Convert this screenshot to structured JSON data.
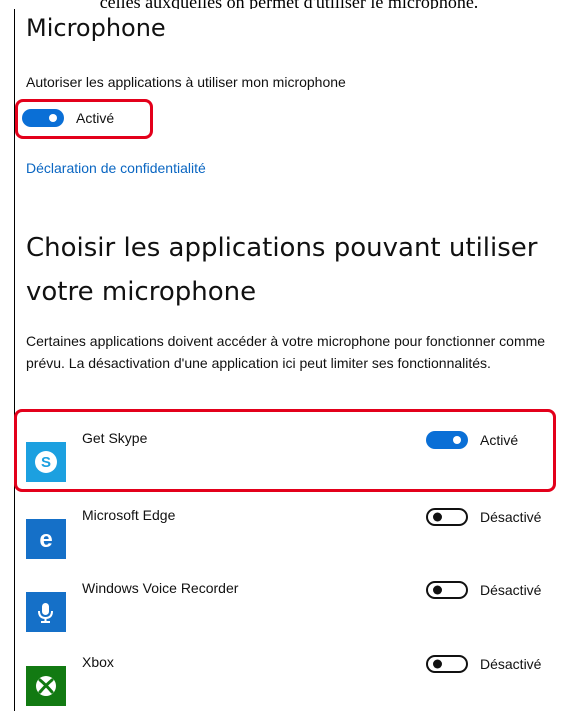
{
  "caption": "celles auxquelles on permet d'utiliser le microphone.",
  "microphone": {
    "title": "Microphone",
    "allow_label": "Autoriser les applications à utiliser mon microphone",
    "toggle_state": "Activé",
    "toggle_on": true,
    "privacy_link": "Déclaration de confidentialité"
  },
  "choose_apps": {
    "title": "Choisir les applications pouvant utiliser votre microphone",
    "description": "Certaines applications doivent accéder à votre microphone pour fonctionner comme prévu. La désactivation d'une application ici peut limiter ses fonctionnalités."
  },
  "apps": [
    {
      "name": "Get Skype",
      "icon": "skype-icon",
      "icon_color": "#1ca0e0",
      "state": "Activé",
      "on": true
    },
    {
      "name": "Microsoft Edge",
      "icon": "edge-icon",
      "icon_color": "#1570c8",
      "state": "Désactivé",
      "on": false
    },
    {
      "name": "Windows Voice Recorder",
      "icon": "voice-recorder-icon",
      "icon_color": "#1570c8",
      "state": "Désactivé",
      "on": false
    },
    {
      "name": "Xbox",
      "icon": "xbox-icon",
      "icon_color": "#127a12",
      "state": "Désactivé",
      "on": false
    }
  ],
  "colors": {
    "accent": "#0a6fd6",
    "link": "#0a66c2",
    "highlight": "#e3001b"
  }
}
